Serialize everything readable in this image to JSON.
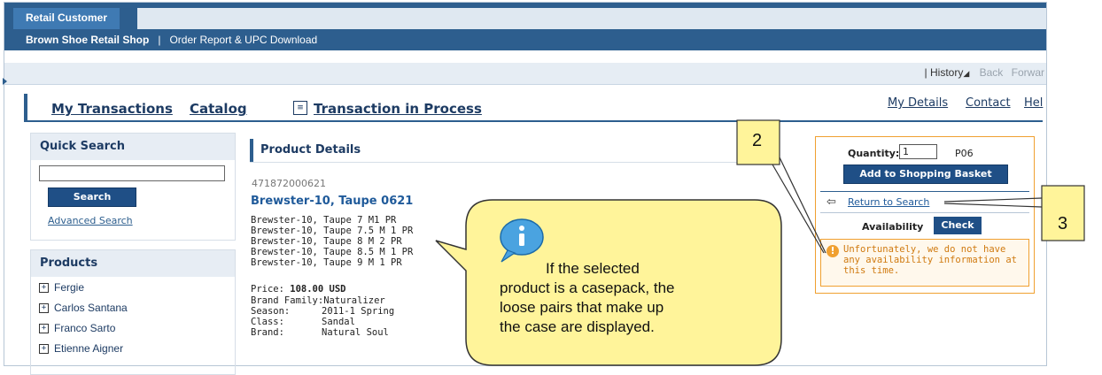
{
  "header": {
    "tab_label": "Retail Customer",
    "shop_link": "Brown Shoe Retail Shop",
    "separator": "|",
    "order_link": "Order Report & UPC Download"
  },
  "history_bar": {
    "separator": "|",
    "history": "History",
    "back": "Back",
    "forward": "Forwar"
  },
  "main_nav": {
    "my_transactions": "My Transactions",
    "catalog": "Catalog",
    "transaction_in_process": "Transaction in Process",
    "my_details": "My Details",
    "contact": "Contact",
    "help": "Hel"
  },
  "quick_search": {
    "title": "Quick Search",
    "input_value": "",
    "button": "Search",
    "advanced": "Advanced Search"
  },
  "products": {
    "title": "Products",
    "items": [
      "Fergie",
      "Carlos Santana",
      "Franco Sarto",
      "Etienne Aigner"
    ]
  },
  "product_details": {
    "title": "Product Details",
    "sku": "471872000621",
    "name": "Brewster-10, Taupe 0621",
    "variants": [
      "Brewster-10, Taupe 7 M1 PR",
      "Brewster-10, Taupe 7.5 M 1 PR",
      "Brewster-10, Taupe 8 M 2 PR",
      "Brewster-10, Taupe 8.5 M 1 PR",
      "Brewster-10, Taupe 9 M 1 PR"
    ],
    "price_label": "Price:",
    "price_value": "108.00 USD",
    "brand_family_label": "Brand Family:",
    "brand_family_value": "Naturalizer",
    "season_label": "Season:",
    "season_value": "2011-1 Spring",
    "class_label": "Class:",
    "class_value": "Sandal",
    "brand_label": "Brand:",
    "brand_value": "Natural Soul"
  },
  "order_panel": {
    "quantity_label": "Quantity:",
    "quantity_value": "1",
    "unit": "P06",
    "add_button": "Add to Shopping Basket",
    "return_link": "Return to Search",
    "availability_label": "Availability",
    "check_button": "Check",
    "availability_message": "Unfortunately, we do not have any availability information at this time."
  },
  "callouts": {
    "info_line1": "If the selected",
    "info_line2": "product is a casepack, the",
    "info_line3": "loose pairs that make up",
    "info_line4": "the case are displayed.",
    "marker_2": "2",
    "marker_3": "3"
  },
  "colors": {
    "header_blue": "#2d5e8e",
    "button_blue": "#1f4f86",
    "orange_border": "#f0a030",
    "callout_fill": "#fff49a"
  }
}
